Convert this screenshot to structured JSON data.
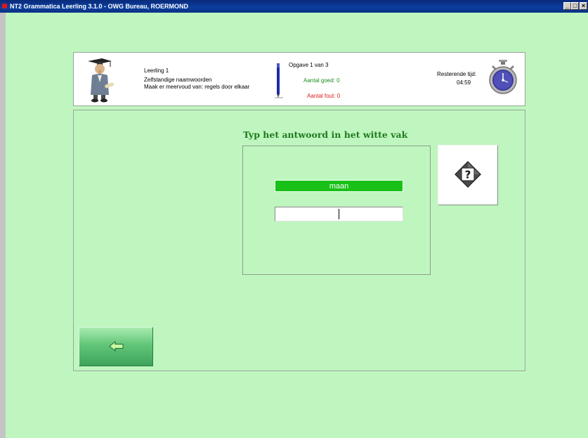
{
  "window": {
    "title": "NT2 Grammatica Leerling  3.1.0 - OWG Bureau, ROERMOND",
    "minimize_label": "_",
    "maximize_label": "□",
    "close_label": "×"
  },
  "header": {
    "student": "Leerling 1",
    "subject": "Zelfstandige naamwoorden",
    "instruction": "Maak er meervoud van: regels door elkaar",
    "progress": "Opgave 1 van 3",
    "correct": "Aantal goed: 0",
    "wrong": "Aantal fout: 0",
    "time_label": "Resterende tijd:",
    "time_value": "04:59"
  },
  "exercise": {
    "prompt": "Typ het antwoord in het witte vak",
    "word": "maan",
    "answer_value": ""
  },
  "colors": {
    "background": "#bff6bf",
    "word_bg": "#18c018",
    "prompt_text": "#1e7a1e",
    "correct_text": "#1e8c1e",
    "wrong_text": "#e01818"
  },
  "icons": {
    "teacher": "graduate-teacher-icon",
    "pen": "pen-icon",
    "stopwatch": "stopwatch-icon",
    "help": "question-mark-icon",
    "back": "arrow-left-icon"
  }
}
